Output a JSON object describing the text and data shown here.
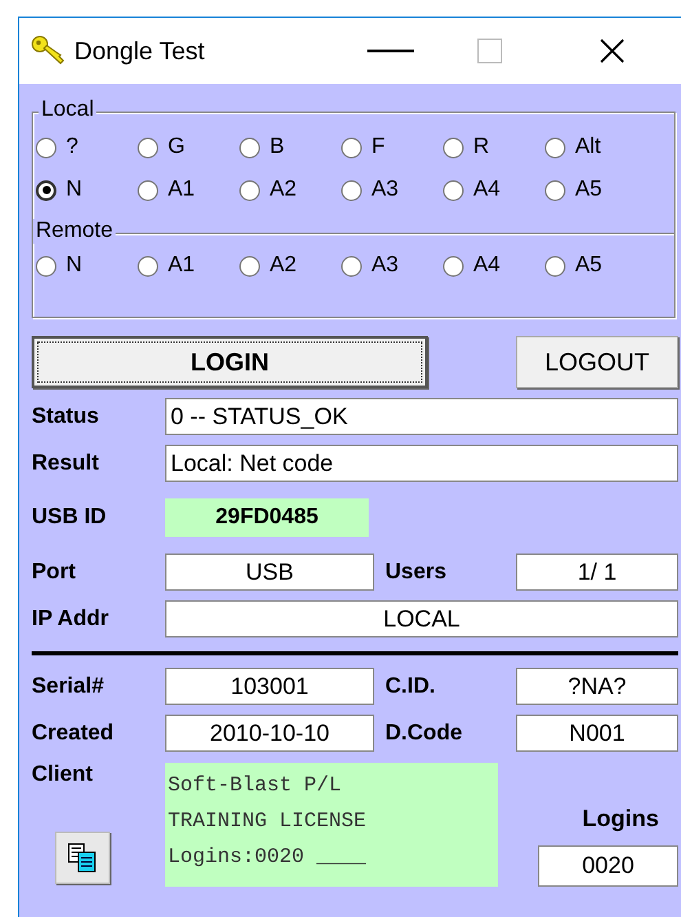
{
  "window": {
    "title": "Dongle Test"
  },
  "local": {
    "title": "Local",
    "options": [
      {
        "label": "?",
        "selected": false
      },
      {
        "label": "G",
        "selected": false
      },
      {
        "label": "B",
        "selected": false
      },
      {
        "label": "F",
        "selected": false
      },
      {
        "label": "R",
        "selected": false
      },
      {
        "label": "Alt",
        "selected": false
      },
      {
        "label": "N",
        "selected": true
      },
      {
        "label": "A1",
        "selected": false
      },
      {
        "label": "A2",
        "selected": false
      },
      {
        "label": "A3",
        "selected": false
      },
      {
        "label": "A4",
        "selected": false
      },
      {
        "label": "A5",
        "selected": false
      }
    ]
  },
  "remote": {
    "title": "Remote",
    "options": [
      {
        "label": "N",
        "selected": false
      },
      {
        "label": "A1",
        "selected": false
      },
      {
        "label": "A2",
        "selected": false
      },
      {
        "label": "A3",
        "selected": false
      },
      {
        "label": "A4",
        "selected": false
      },
      {
        "label": "A5",
        "selected": false
      }
    ]
  },
  "buttons": [
    {
      "label": "LOGIN",
      "focused": true
    },
    {
      "label": "LOGOUT",
      "focused": false
    }
  ],
  "status": {
    "label": "Status",
    "value": "0 -- STATUS_OK"
  },
  "result": {
    "label": "Result",
    "value": "Local: Net code"
  },
  "usb_id": {
    "label": "USB ID",
    "value": "29FD0485"
  },
  "port": {
    "label": "Port",
    "value": "USB"
  },
  "users": {
    "label": "Users",
    "value": "1/ 1"
  },
  "ip_addr": {
    "label": "IP Addr",
    "value": "LOCAL"
  },
  "serial": {
    "label": "Serial#",
    "value": "103001"
  },
  "cid": {
    "label": "C.ID.",
    "value": "?NA?"
  },
  "created": {
    "label": "Created",
    "value": "2010-10-10"
  },
  "dcode": {
    "label": "D.Code",
    "value": "N001"
  },
  "client": {
    "label": "Client",
    "lines": [
      "Soft-Blast P/L",
      "TRAINING LICENSE",
      "Logins:0020 ____"
    ]
  },
  "logins": {
    "label": "Logins",
    "value": "0020"
  }
}
